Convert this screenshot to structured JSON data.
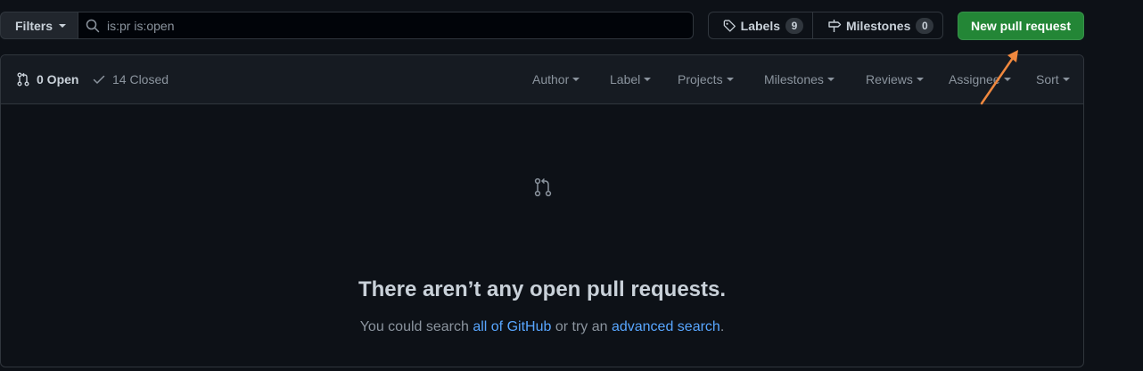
{
  "toolbar": {
    "filters_label": "Filters",
    "search_value": "is:pr is:open",
    "labels_label": "Labels",
    "labels_count": "9",
    "milestones_label": "Milestones",
    "milestones_count": "0",
    "new_pr_label": "New pull request"
  },
  "header": {
    "open_label": "0 Open",
    "closed_label": "14 Closed",
    "menus": [
      "Author",
      "Label",
      "Projects",
      "Milestones",
      "Reviews",
      "Assignee",
      "Sort"
    ]
  },
  "blankslate": {
    "title": "There aren’t any open pull requests.",
    "desc_prefix": "You could search ",
    "link1": "all of GitHub",
    "desc_middle": " or try an ",
    "link2": "advanced search",
    "desc_suffix": "."
  },
  "colors": {
    "background": "#0d1117",
    "header_bg": "#161b22",
    "border": "#30363d",
    "primary_button": "#238636",
    "link": "#58a6ff",
    "annotation": "#f0883e"
  },
  "icons": {
    "search": "search-icon",
    "tag": "tag-icon",
    "milestone": "milestone-icon",
    "pull_request": "git-pull-request-icon",
    "check": "check-icon"
  }
}
